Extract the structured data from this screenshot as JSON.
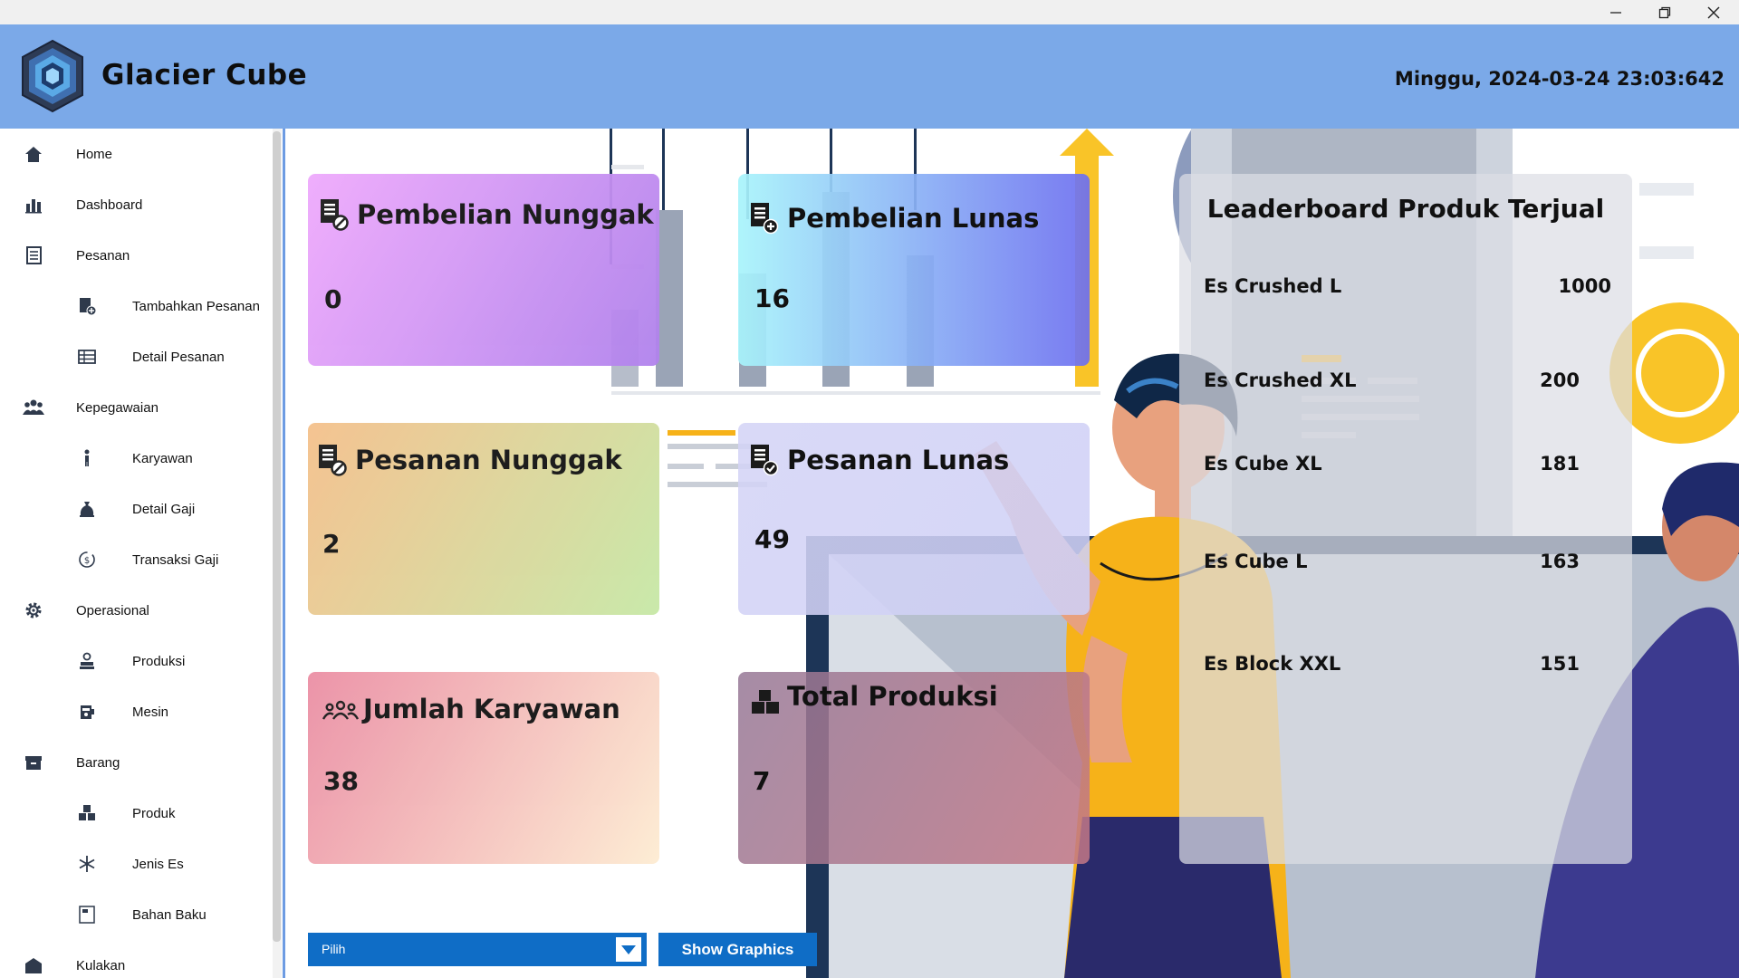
{
  "window": {
    "minimize_icon": "minimize-icon",
    "restore_icon": "restore-icon",
    "close_icon": "close-icon"
  },
  "header": {
    "app_title": "Glacier Cube",
    "datetime": "Minggu, 2024-03-24 23:03:642",
    "background": "#7ba9e8"
  },
  "sidebar": {
    "items": [
      {
        "label": "Home",
        "icon": "home-icon",
        "level": 0
      },
      {
        "label": "Dashboard",
        "icon": "bar-chart-icon",
        "level": 0
      },
      {
        "label": "Pesanan",
        "icon": "document-list-icon",
        "level": 0
      },
      {
        "label": "Tambahkan Pesanan",
        "icon": "add-document-icon",
        "level": 1
      },
      {
        "label": "Detail Pesanan",
        "icon": "table-icon",
        "level": 1
      },
      {
        "label": "Kepegawaian",
        "icon": "people-group-icon",
        "level": 0
      },
      {
        "label": "Karyawan",
        "icon": "person-icon",
        "level": 1
      },
      {
        "label": "Detail Gaji",
        "icon": "money-bag-icon",
        "level": 1
      },
      {
        "label": "Transaksi Gaji",
        "icon": "money-refresh-icon",
        "level": 1
      },
      {
        "label": "Operasional",
        "icon": "gear-icon",
        "level": 0
      },
      {
        "label": "Produksi",
        "icon": "machine-operator-icon",
        "level": 1
      },
      {
        "label": "Mesin",
        "icon": "machine-icon",
        "level": 1
      },
      {
        "label": "Barang",
        "icon": "box-icon",
        "level": 0
      },
      {
        "label": "Produk",
        "icon": "boxes-stack-icon",
        "level": 1
      },
      {
        "label": "Jenis Es",
        "icon": "snowflake-icon",
        "level": 1
      },
      {
        "label": "Bahan Baku",
        "icon": "material-icon",
        "level": 1
      },
      {
        "label": "Kulakan",
        "icon": "warehouse-icon",
        "level": 0
      }
    ]
  },
  "cards": [
    {
      "title": "Pembelian Nunggak",
      "value": "0",
      "icon": "document-cancel-icon",
      "gradient_from": "#efaafc",
      "gradient_to": "#b082ec"
    },
    {
      "title": "Pembelian Lunas",
      "value": "16",
      "icon": "document-add-icon",
      "gradient_from": "#a8f4fb",
      "gradient_to": "#6d6ff0"
    },
    {
      "title": "Pesanan Nunggak",
      "value": "2",
      "icon": "document-cancel-icon",
      "gradient_from": "#f5c08c",
      "gradient_to": "#c6e8a6"
    },
    {
      "title": "Pesanan Lunas",
      "value": "49",
      "icon": "document-check-icon",
      "gradient_from": "#d4d4f6",
      "gradient_to": "#cfd0f6"
    },
    {
      "title": "Jumlah Karyawan",
      "value": "38",
      "icon": "people-group-icon",
      "gradient_from": "#eb8ea4",
      "gradient_to": "#fdecd2"
    },
    {
      "title": "Total Produksi",
      "value": "7",
      "icon": "boxes-stack-icon",
      "gradient_from": "#9e7a96",
      "gradient_to": "#c07b86"
    }
  ],
  "leaderboard": {
    "title": "Leaderboard Produk Terjual",
    "rows": [
      {
        "name": "Es Crushed L",
        "value": "1000"
      },
      {
        "name": "Es Crushed XL",
        "value": "200"
      },
      {
        "name": "Es Cube XL",
        "value": "181"
      },
      {
        "name": "Es Cube L",
        "value": "163"
      },
      {
        "name": "Es Block XXL",
        "value": "151"
      }
    ]
  },
  "controls": {
    "select_value": "Pilih",
    "show_button": "Show Graphics",
    "accent": "#0f6dc6"
  }
}
